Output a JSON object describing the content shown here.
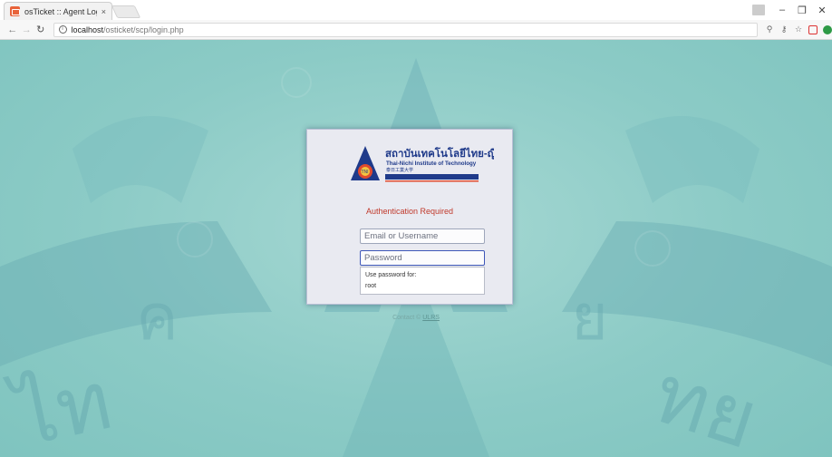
{
  "browser": {
    "tab_title": "osTicket :: Agent Login",
    "tab_close": "×",
    "url_host": "localhost",
    "url_path": "/osticket/scp/login.php"
  },
  "login": {
    "org_name_thai": "สถาบันเทคโนโลยีไทย-ญี่ปุ่น",
    "org_name_en": "Thai-Nichi Institute of Technology",
    "org_name_jp": "泰日工業大学",
    "auth_message": "Authentication Required",
    "email_placeholder": "Email or Username",
    "password_placeholder": "Password",
    "autofill_hint": "Use password for:",
    "autofill_user": "root"
  },
  "footer": {
    "contact_prefix": "Contact ©",
    "contact_link": "ULRS"
  },
  "colors": {
    "background": "#8ccbc6",
    "login_box": "#e9eaf1",
    "auth_message": "#c0392b",
    "focus_border": "#3e57b8"
  }
}
